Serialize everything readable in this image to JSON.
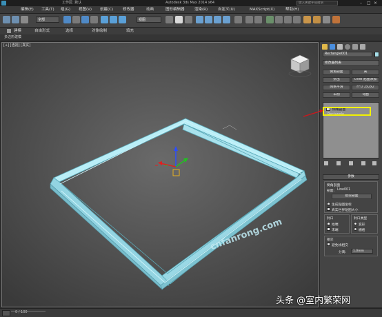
{
  "titlebar": {
    "workspace": "工作区: 默认",
    "app_title": "Autodesk 3ds Max  2014 x64",
    "search_placeholder": "键入关键字或短语"
  },
  "menu": [
    "编辑(E)",
    "工具(T)",
    "组(G)",
    "视图(V)",
    "创建(C)",
    "修改器",
    "动画",
    "图形编辑器",
    "渲染(R)",
    "自定义(U)",
    "MAXScript(X)",
    "帮助(H)"
  ],
  "toolbar": {
    "selection_filter": "全部",
    "view_dropdown": "视图"
  },
  "ribbon": {
    "tabs": [
      "建模",
      "自由形式",
      "选择",
      "对象绘制",
      "填充"
    ],
    "subtab": "多边形建模"
  },
  "viewport": {
    "label": "[+] [透视] [真实]"
  },
  "panel": {
    "object_name": "Rectangle001",
    "modifier_list": "修改器列表",
    "buttons": [
      [
        "倒角剖面",
        "壳"
      ],
      [
        "挤出",
        "UVW 贴图添加"
      ],
      [
        "网格平滑",
        "FFD 2x2x2"
      ],
      [
        "车削",
        "弯曲"
      ]
    ],
    "stack": [
      "倒角剖面",
      "Rectangle"
    ],
    "params_header": "参数",
    "bevel_profile": "倒角剖面",
    "profile_label": "剖面:",
    "profile_value": "Line001",
    "pick_profile": "拾取剖面",
    "gen_mapping": "生成贴图坐标",
    "real_world": "真实世界贴图大小",
    "capping_title": "封口",
    "cap_start": "始端",
    "cap_end": "末端",
    "cap_type_title": "封口类型",
    "morph": "变形",
    "grid": "栅格",
    "intersect_title": "相交",
    "avoid_intersect": "避免线相交",
    "separation_label": "分离:",
    "separation_value": "1.0mm"
  },
  "status": {
    "frame": "0 / 100"
  },
  "watermarks": {
    "site": "cnfanrong.com",
    "toutiao": "头条 @室内繁荣网"
  },
  "colors": {
    "frame": "#a8e0ea",
    "highlight_box": "#f2f200",
    "arrow": "#d4141a"
  }
}
